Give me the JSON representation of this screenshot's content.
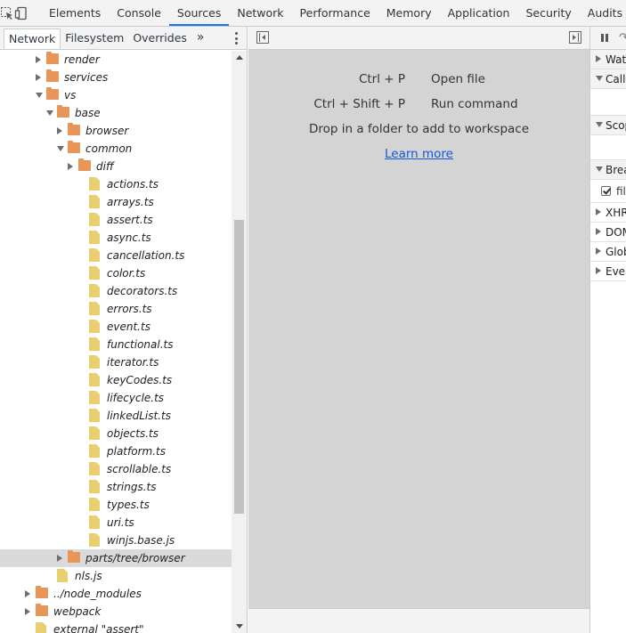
{
  "topbar": {
    "tabs": [
      {
        "label": "Elements"
      },
      {
        "label": "Console"
      },
      {
        "label": "Sources"
      },
      {
        "label": "Network"
      },
      {
        "label": "Performance"
      },
      {
        "label": "Memory"
      },
      {
        "label": "Application"
      },
      {
        "label": "Security"
      },
      {
        "label": "Audits"
      }
    ],
    "active_tab": "Sources"
  },
  "navigator": {
    "tabs": [
      {
        "label": "Network"
      },
      {
        "label": "Filesystem"
      },
      {
        "label": "Overrides"
      }
    ],
    "more_label": "»"
  },
  "tree": [
    {
      "label": "render",
      "type": "folder",
      "expanded": false,
      "depth": 0
    },
    {
      "label": "services",
      "type": "folder",
      "expanded": false,
      "depth": 0
    },
    {
      "label": "vs",
      "type": "folder",
      "expanded": true,
      "depth": 0
    },
    {
      "label": "base",
      "type": "folder",
      "expanded": true,
      "depth": 1
    },
    {
      "label": "browser",
      "type": "folder",
      "expanded": false,
      "depth": 2
    },
    {
      "label": "common",
      "type": "folder",
      "expanded": true,
      "depth": 2
    },
    {
      "label": "diff",
      "type": "folder",
      "expanded": false,
      "depth": 3
    },
    {
      "label": "actions.ts",
      "type": "file",
      "depth": 3
    },
    {
      "label": "arrays.ts",
      "type": "file",
      "depth": 3
    },
    {
      "label": "assert.ts",
      "type": "file",
      "depth": 3
    },
    {
      "label": "async.ts",
      "type": "file",
      "depth": 3
    },
    {
      "label": "cancellation.ts",
      "type": "file",
      "depth": 3
    },
    {
      "label": "color.ts",
      "type": "file",
      "depth": 3
    },
    {
      "label": "decorators.ts",
      "type": "file",
      "depth": 3
    },
    {
      "label": "errors.ts",
      "type": "file",
      "depth": 3
    },
    {
      "label": "event.ts",
      "type": "file",
      "depth": 3
    },
    {
      "label": "functional.ts",
      "type": "file",
      "depth": 3
    },
    {
      "label": "iterator.ts",
      "type": "file",
      "depth": 3
    },
    {
      "label": "keyCodes.ts",
      "type": "file",
      "depth": 3
    },
    {
      "label": "lifecycle.ts",
      "type": "file",
      "depth": 3
    },
    {
      "label": "linkedList.ts",
      "type": "file",
      "depth": 3
    },
    {
      "label": "objects.ts",
      "type": "file",
      "depth": 3
    },
    {
      "label": "platform.ts",
      "type": "file",
      "depth": 3
    },
    {
      "label": "scrollable.ts",
      "type": "file",
      "depth": 3
    },
    {
      "label": "strings.ts",
      "type": "file",
      "depth": 3
    },
    {
      "label": "types.ts",
      "type": "file",
      "depth": 3
    },
    {
      "label": "uri.ts",
      "type": "file",
      "depth": 3
    },
    {
      "label": "winjs.base.js",
      "type": "file",
      "depth": 3
    },
    {
      "label": "parts/tree/browser",
      "type": "folder",
      "expanded": false,
      "depth": 2,
      "selected": true
    },
    {
      "label": "nls.js",
      "type": "file",
      "depth": 1
    },
    {
      "label": "../node_modules",
      "type": "folder",
      "expanded": false,
      "depth": -1
    },
    {
      "label": "webpack",
      "type": "folder",
      "expanded": false,
      "depth": -1
    },
    {
      "label": "external \"assert\"",
      "type": "file",
      "depth": -1
    }
  ],
  "editor": {
    "shortcuts": [
      {
        "keys": "Ctrl + P",
        "action": "Open file"
      },
      {
        "keys": "Ctrl + Shift + P",
        "action": "Run command"
      }
    ],
    "hint": "Drop in a folder to add to workspace",
    "learn_more": "Learn more"
  },
  "debugger": {
    "sections": [
      {
        "label": "Watch",
        "expanded": false
      },
      {
        "label": "Call Stack",
        "expanded": true
      },
      {
        "label": "Scope",
        "expanded": true
      },
      {
        "label": "Breakpoints",
        "expanded": true
      },
      {
        "label": "XHR/fetch Breakpoints",
        "expanded": false
      },
      {
        "label": "DOM Breakpoints",
        "expanded": false
      },
      {
        "label": "Global Listeners",
        "expanded": false
      },
      {
        "label": "Event Listener Breakpoints",
        "expanded": false
      }
    ],
    "breakpoint_item": "file"
  }
}
